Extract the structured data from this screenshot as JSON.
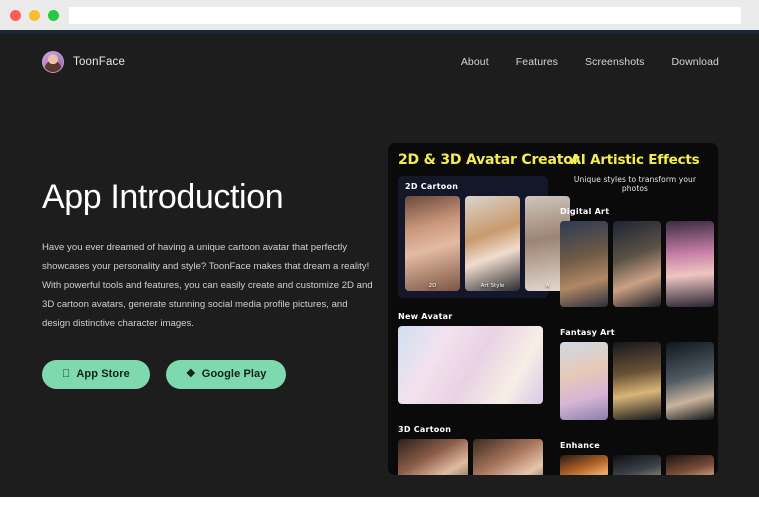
{
  "browser": {
    "traffic_lights": [
      "close",
      "minimize",
      "maximize"
    ],
    "address_value": "",
    "address_placeholder": ""
  },
  "header": {
    "brand_name": "ToonFace",
    "nav": [
      {
        "label": "About"
      },
      {
        "label": "Features"
      },
      {
        "label": "Screenshots"
      },
      {
        "label": "Download"
      }
    ]
  },
  "hero": {
    "title": "App Introduction",
    "body": "Have you ever dreamed of having a unique cartoon avatar that perfectly showcases your personality and style? ToonFace makes that dream a reality! With powerful tools and features, you can easily create and customize 2D and 3D cartoon avatars, generate stunning social media profile pictures, and design distinctive character images.",
    "buttons": [
      {
        "label": "App Store",
        "glyph": "",
        "icon": "apple-icon"
      },
      {
        "label": "Google Play",
        "glyph": "❖",
        "icon": "google-play-icon"
      }
    ]
  },
  "promo": {
    "left": {
      "heading": "2D & 3D Avatar Creator",
      "sections": [
        {
          "label": "2D Cartoon",
          "thumbs": [
            {
              "caption": "2D"
            },
            {
              "caption": "Art Style"
            },
            {
              "caption": "A"
            }
          ]
        },
        {
          "label": "New Avatar",
          "thumbs": [
            {
              "caption": ""
            }
          ]
        },
        {
          "label": "3D Cartoon",
          "thumbs": [
            {
              "caption": ""
            },
            {
              "caption": ""
            }
          ]
        }
      ]
    },
    "right": {
      "heading": "AI  Artistic Effects",
      "subtitle": "Unique styles to transform your photos",
      "sections": [
        {
          "label": "Digital Art",
          "thumbs": [
            {},
            {},
            {}
          ]
        },
        {
          "label": "Fantasy Art",
          "thumbs": [
            {},
            {},
            {}
          ]
        },
        {
          "label": "Enhance",
          "thumbs": [
            {},
            {},
            {}
          ]
        }
      ]
    }
  },
  "colors": {
    "page_background": "#1d1d1d",
    "accent_green": "#7fd9ae",
    "promo_yellow": "#f3ee4e",
    "promo_panel": "#0a0a0a",
    "section_card": "#14172a",
    "chrome": "#ebebeb"
  }
}
